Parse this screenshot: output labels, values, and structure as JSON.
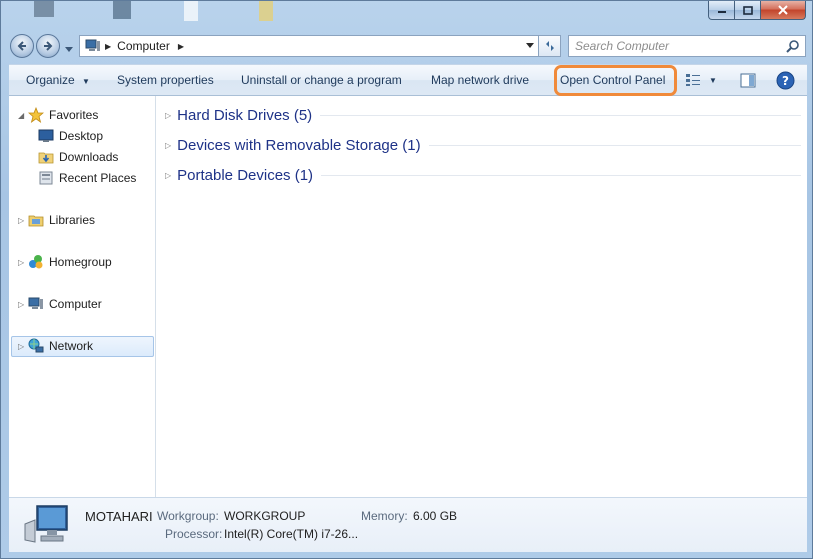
{
  "window": {
    "colors": {
      "glass": "#a8c6e2",
      "highlight": "#f08a3a",
      "link": "#1e3287",
      "toolbar_text": "#1e395b"
    }
  },
  "address": {
    "crumb": "Computer",
    "search_placeholder": "Search Computer"
  },
  "toolbar": {
    "organize": "Organize",
    "system_properties": "System properties",
    "uninstall": "Uninstall or change a program",
    "map_drive": "Map network drive",
    "control_panel": "Open Control Panel"
  },
  "navpane": {
    "favorites": "Favorites",
    "desktop": "Desktop",
    "downloads": "Downloads",
    "recent": "Recent Places",
    "libraries": "Libraries",
    "homegroup": "Homegroup",
    "computer": "Computer",
    "network": "Network"
  },
  "groups": [
    {
      "label": "Hard Disk Drives (5)"
    },
    {
      "label": "Devices with Removable Storage (1)"
    },
    {
      "label": "Portable Devices (1)"
    }
  ],
  "details": {
    "name": "MOTAHARI",
    "workgroup_label": "Workgroup:",
    "workgroup_value": "WORKGROUP",
    "memory_label": "Memory:",
    "memory_value": "6.00 GB",
    "processor_label": "Processor:",
    "processor_value": "Intel(R) Core(TM) i7-26..."
  }
}
